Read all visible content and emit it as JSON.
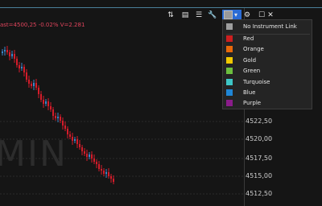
{
  "info_line": "ast=4500,25  -0.02%  V=2.281",
  "watermark": "MIN",
  "price_axis": [
    "4522,50",
    "4520,00",
    "4517,50",
    "4515,00",
    "4512,50"
  ],
  "toolbar": {
    "sort": "⇅",
    "indicators": "▤",
    "properties": "☰",
    "wrench": "🔧",
    "dropdown_caret": "▾",
    "gear": "⚙",
    "maximize": "☐",
    "close": "✕"
  },
  "link_menu": {
    "items": [
      {
        "label": "No Instrument Link",
        "color": "#9e9e9e"
      },
      {
        "label": "Red",
        "color": "#cc1f1f"
      },
      {
        "label": "Orange",
        "color": "#e8680a"
      },
      {
        "label": "Gold",
        "color": "#f0c800"
      },
      {
        "label": "Green",
        "color": "#6cbf3e"
      },
      {
        "label": "Turquoise",
        "color": "#3ec6c6"
      },
      {
        "label": "Blue",
        "color": "#1f86d6"
      },
      {
        "label": "Purple",
        "color": "#8a1c8a"
      }
    ]
  }
}
